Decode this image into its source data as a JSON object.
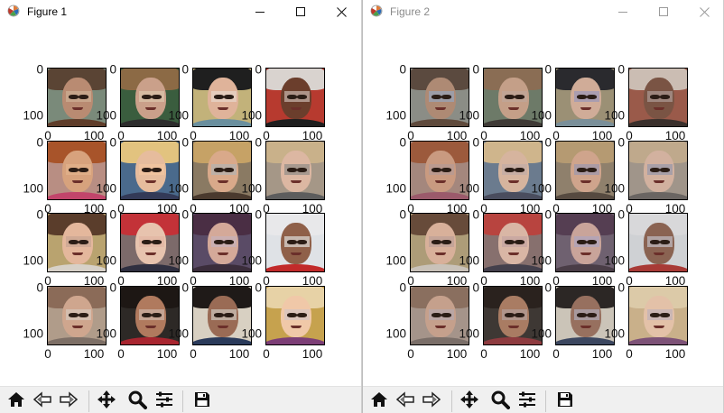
{
  "windows": [
    {
      "title": "Figure 1",
      "active": true,
      "controls": {
        "minimize_icon": "minimize-icon",
        "maximize_icon": "maximize-icon",
        "close_icon": "close-icon"
      },
      "tick_labels": {
        "y": [
          "0",
          "100"
        ],
        "x": [
          "0",
          "100"
        ]
      },
      "grid": {
        "rows": 4,
        "cols": 4
      },
      "faces": [
        {
          "bg": "#7a8a7a",
          "skin": "#b98b72",
          "hair": "#5a4434",
          "clothes": "#5f3d2a",
          "patch": "#c9a98f"
        },
        {
          "bg": "#3a5d3e",
          "skin": "#caa08a",
          "hair": "#8c6a45",
          "clothes": "#2d2d2d",
          "patch": "#d8c0a6"
        },
        {
          "bg": "#c2b27a",
          "skin": "#dfb39a",
          "hair": "#1f1f1f",
          "clothes": "#6a8f9e",
          "patch": "#e6d0c2"
        },
        {
          "bg": "#b73a2f",
          "skin": "#6b3e2c",
          "hair": "#d9d3cf",
          "clothes": "#1e1e1e",
          "patch": "#b9a299"
        },
        {
          "bg": "#b88e83",
          "skin": "#d7a27d",
          "hair": "#a8542a",
          "clothes": "#c2456b",
          "patch": "#e0b08a"
        },
        {
          "bg": "#4a6a8c",
          "skin": "#e6bc9d",
          "hair": "#e2c37f",
          "clothes": "#333a57",
          "patch": "#f0c4a0"
        },
        {
          "bg": "#8a7a63",
          "skin": "#d9a98a",
          "hair": "#c6a266",
          "clothes": "#4a3a2e",
          "patch": "#b9b2aa"
        },
        {
          "bg": "#a59787",
          "skin": "#dcb7a2",
          "hair": "#c9b18a",
          "clothes": "#5d5d5d",
          "patch": "#9d948c"
        },
        {
          "bg": "#b9a36f",
          "skin": "#e4b79c",
          "hair": "#5a3d2b",
          "clothes": "#d7d1c8",
          "patch": "#cda894"
        },
        {
          "bg": "#7c6a6a",
          "skin": "#e7c3ae",
          "hair": "#c33238",
          "clothes": "#2f2f40",
          "patch": "#e2b7a5"
        },
        {
          "bg": "#5a4b66",
          "skin": "#d4a999",
          "hair": "#4a2e44",
          "clothes": "#3b2d3b",
          "patch": "#c8b0b5"
        },
        {
          "bg": "#dfe2e6",
          "skin": "#8f6049",
          "hair": "#e8e8ea",
          "clothes": "#c22a2a",
          "patch": "#d1c8c1"
        },
        {
          "bg": "#b09c8a",
          "skin": "#cfa68e",
          "hair": "#8b6b58",
          "clothes": "#7d6f66",
          "patch": "#d5c2b5"
        },
        {
          "bg": "#2d2926",
          "skin": "#b07a5e",
          "hair": "#1d1714",
          "clothes": "#a8252f",
          "patch": "#c9ab9c"
        },
        {
          "bg": "#d8d0c2",
          "skin": "#9a6b55",
          "hair": "#1f1a18",
          "clothes": "#2a3a5a",
          "patch": "#c4b7ad"
        },
        {
          "bg": "#c6a24e",
          "skin": "#f0c8a8",
          "hair": "#e7d2a6",
          "clothes": "#7c3e76",
          "patch": "#d7c4c0"
        }
      ]
    },
    {
      "title": "Figure 2",
      "active": false,
      "controls": {
        "minimize_icon": "minimize-icon",
        "maximize_icon": "maximize-icon",
        "close_icon": "close-icon"
      },
      "tick_labels": {
        "y": [
          "0",
          "100"
        ],
        "x": [
          "0",
          "100"
        ]
      },
      "grid": {
        "rows": 4,
        "cols": 4
      },
      "faces": [
        {
          "bg": "#8b8d86",
          "skin": "#ae8a74",
          "hair": "#5b4a3f",
          "clothes": "#5f4a3c",
          "patch": "#9aa0b0"
        },
        {
          "bg": "#6d7a68",
          "skin": "#c49f88",
          "hair": "#8a6d54",
          "clothes": "#3f3a36",
          "patch": "#c0a596"
        },
        {
          "bg": "#9b9075",
          "skin": "#d0ac98",
          "hair": "#2a2a2e",
          "clothes": "#7a8f99",
          "patch": "#a39ab3"
        },
        {
          "bg": "#9a5a4a",
          "skin": "#7a5444",
          "hair": "#cbbdb3",
          "clothes": "#3a302c",
          "patch": "#a58f88"
        },
        {
          "bg": "#a4877d",
          "skin": "#c99a80",
          "hair": "#9c5a3c",
          "clothes": "#9b5a6b",
          "patch": "#b79a92"
        },
        {
          "bg": "#6b7b8e",
          "skin": "#d6b49e",
          "hair": "#cfb58c",
          "clothes": "#4a4d5e",
          "patch": "#c4ada4"
        },
        {
          "bg": "#8f806c",
          "skin": "#cfa48c",
          "hair": "#b59a72",
          "clothes": "#564a40",
          "patch": "#a59aa8"
        },
        {
          "bg": "#a0958a",
          "skin": "#d2b19f",
          "hair": "#bfa98c",
          "clothes": "#6a6562",
          "patch": "#a19ca8"
        },
        {
          "bg": "#ad9c78",
          "skin": "#d8b09a",
          "hair": "#674b3a",
          "clothes": "#c9c2b9",
          "patch": "#c1a298"
        },
        {
          "bg": "#87706e",
          "skin": "#d9b6a5",
          "hair": "#b8443f",
          "clothes": "#44404c",
          "patch": "#c7a7a1"
        },
        {
          "bg": "#6f6170",
          "skin": "#c9a49a",
          "hair": "#553e52",
          "clothes": "#4a3d47",
          "patch": "#b1a4b8"
        },
        {
          "bg": "#cfd1d4",
          "skin": "#8a6352",
          "hair": "#d8d8da",
          "clothes": "#a83a36",
          "patch": "#b7aeb2"
        },
        {
          "bg": "#a5948a",
          "skin": "#c5a08c",
          "hair": "#8a6f5f",
          "clothes": "#7a6e68",
          "patch": "#b7a7a8"
        },
        {
          "bg": "#3e3834",
          "skin": "#a97c63",
          "hair": "#2a221e",
          "clothes": "#8e3b3f",
          "patch": "#b29a92"
        },
        {
          "bg": "#cbc4b8",
          "skin": "#97705f",
          "hair": "#2c2725",
          "clothes": "#3c4760",
          "patch": "#aaa0a8"
        },
        {
          "bg": "#c9b08a",
          "skin": "#e3c1a8",
          "hair": "#dccaa8",
          "clothes": "#7d5277",
          "patch": "#c6b4b6"
        }
      ]
    }
  ],
  "toolbar": {
    "buttons": [
      {
        "name": "home-button",
        "icon": "home-icon"
      },
      {
        "name": "back-button",
        "icon": "back-arrow-icon"
      },
      {
        "name": "forward-button",
        "icon": "forward-arrow-icon"
      },
      {
        "name": "pan-button",
        "icon": "move-icon"
      },
      {
        "name": "zoom-button",
        "icon": "magnifier-icon"
      },
      {
        "name": "configure-subplots-button",
        "icon": "sliders-icon"
      },
      {
        "name": "save-button",
        "icon": "save-icon"
      }
    ]
  }
}
